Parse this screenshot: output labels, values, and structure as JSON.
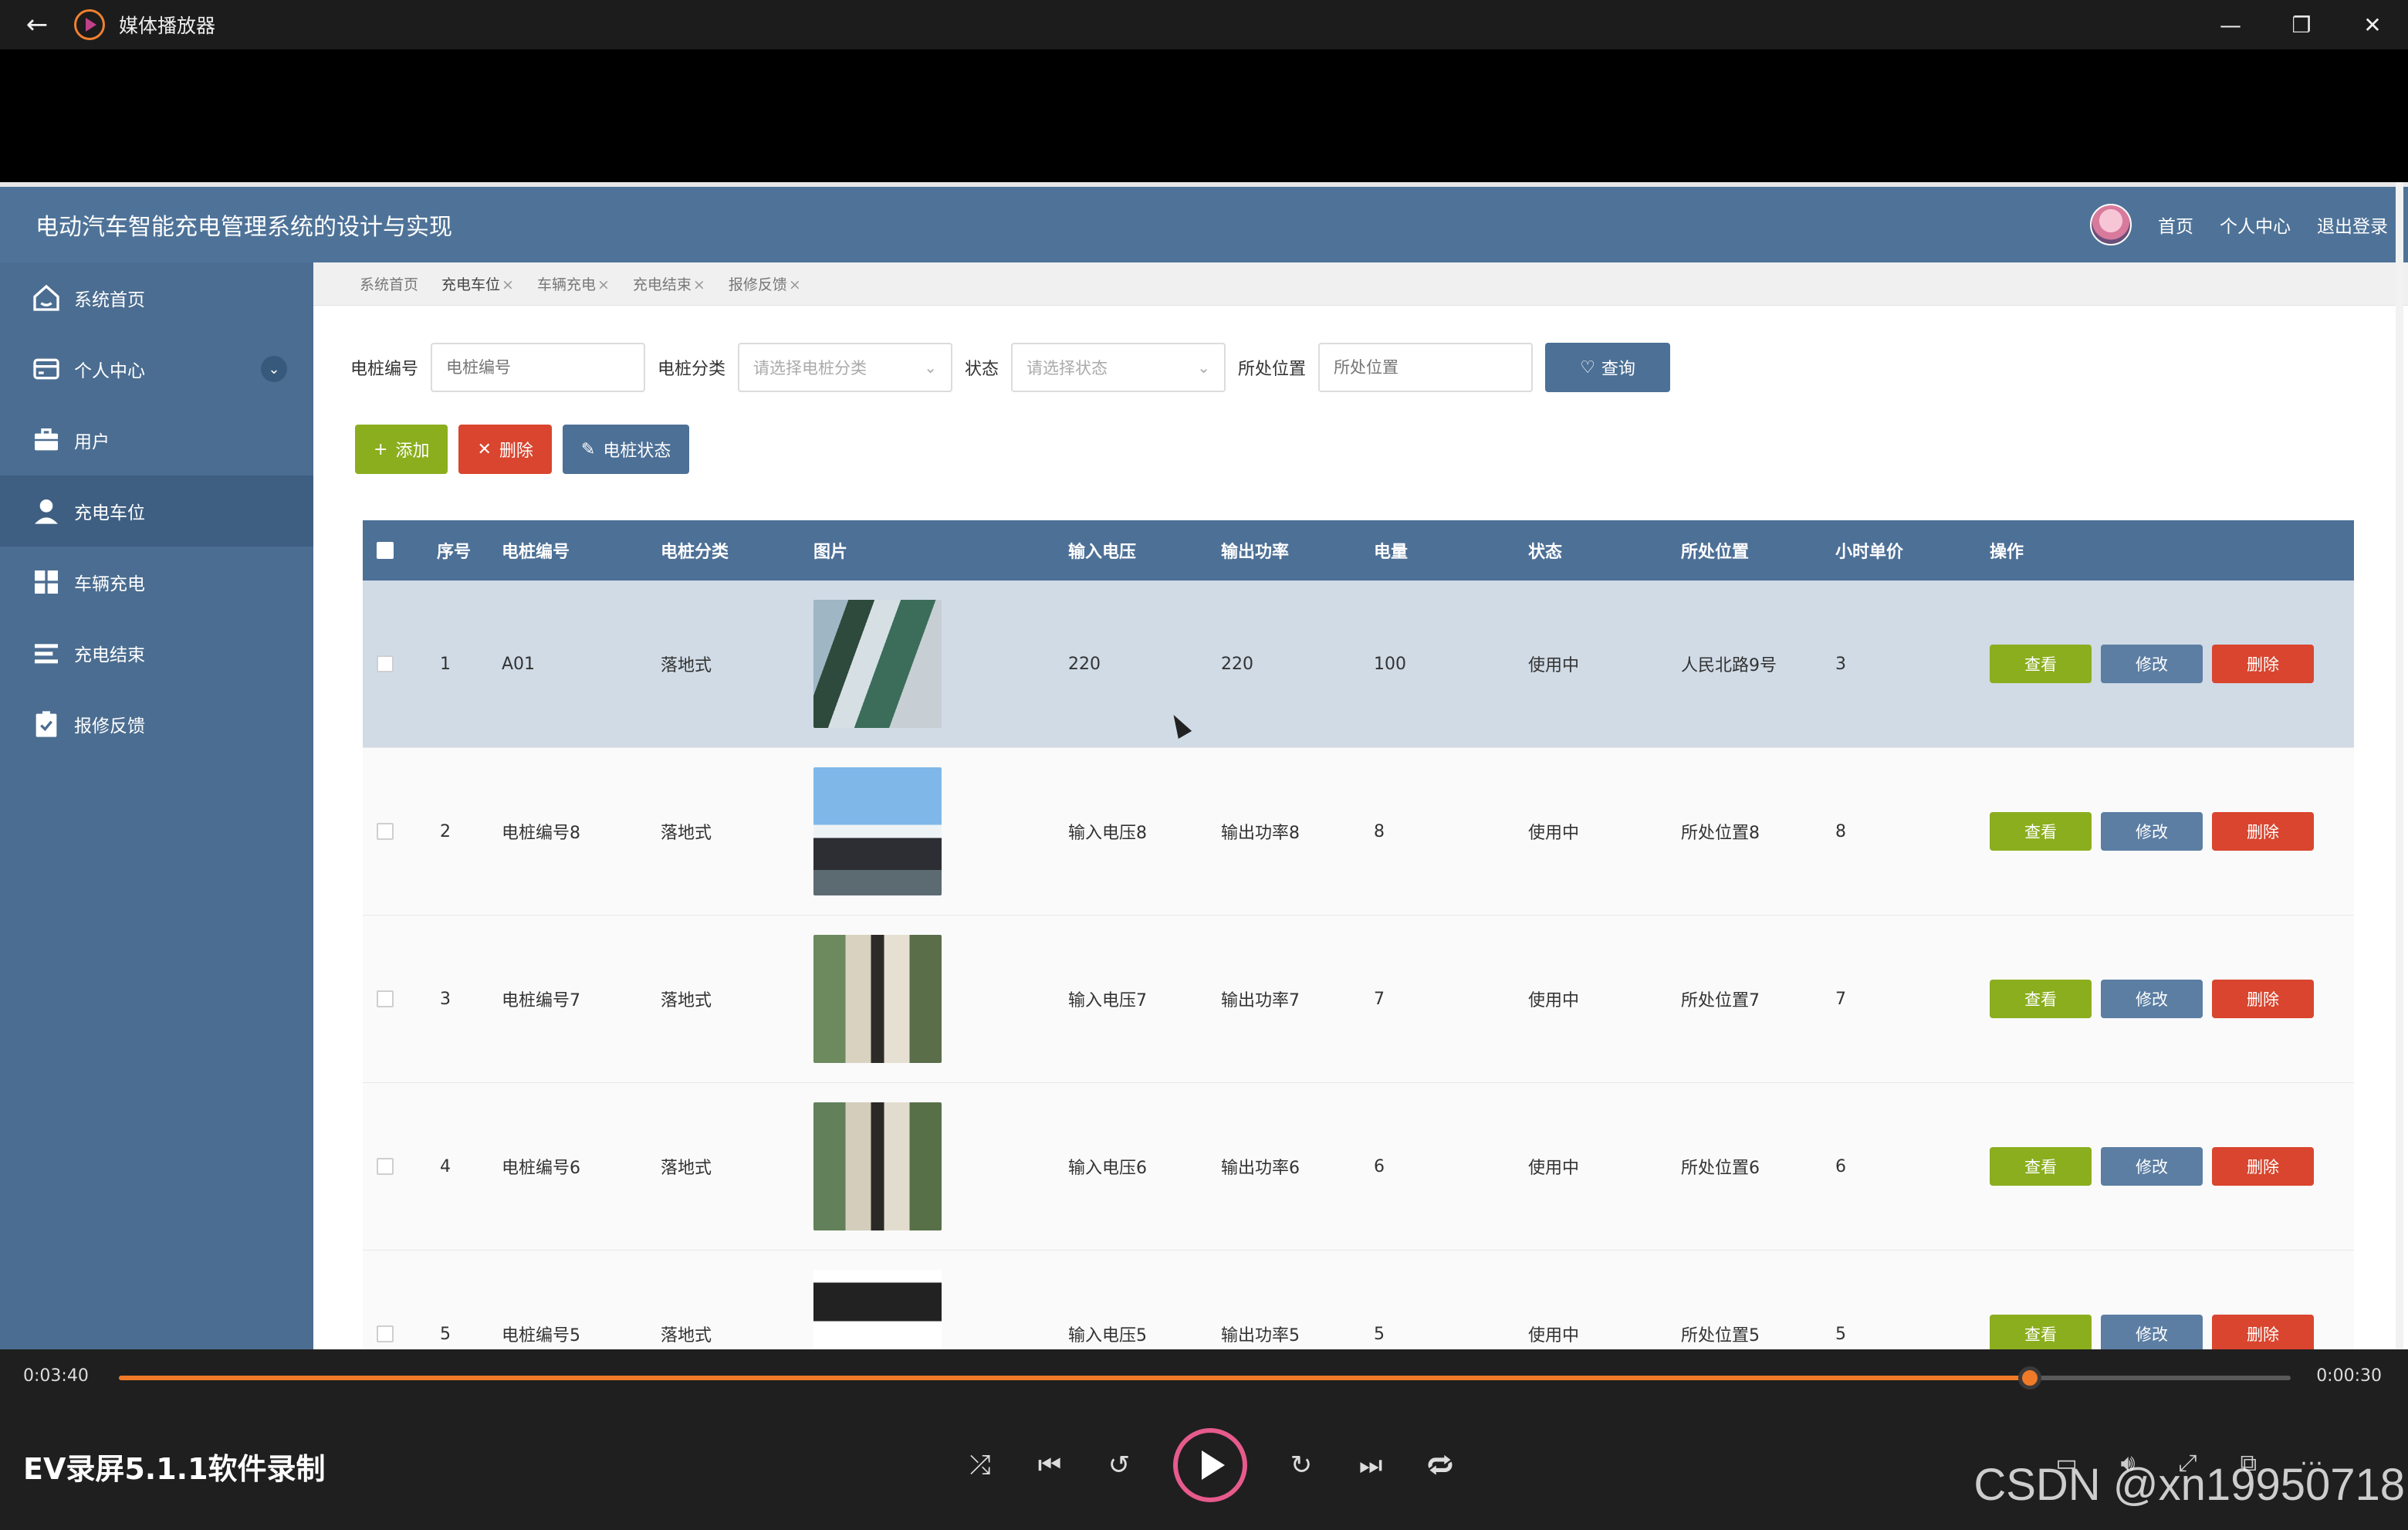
{
  "window": {
    "title": "媒体播放器",
    "controls": {
      "minimize": "—",
      "restore": "❐",
      "close": "✕"
    }
  },
  "app": {
    "title": "电动汽车智能充电管理系统的设计与实现",
    "header_links": [
      "首页",
      "个人中心",
      "退出登录"
    ]
  },
  "sidebar": {
    "items": [
      {
        "label": "系统首页",
        "icon": "home-icon"
      },
      {
        "label": "个人中心",
        "icon": "wallet-icon"
      },
      {
        "label": "用户",
        "icon": "briefcase-icon"
      },
      {
        "label": "充电车位",
        "icon": "person-icon"
      },
      {
        "label": "车辆充电",
        "icon": "grid-icon"
      },
      {
        "label": "充电结束",
        "icon": "list-icon"
      },
      {
        "label": "报修反馈",
        "icon": "clipboard-check-icon"
      }
    ]
  },
  "tabs": [
    "系统首页",
    "充电车位",
    "车辆充电",
    "充电结束",
    "报修反馈"
  ],
  "search": {
    "code_label": "电桩编号",
    "code_placeholder": "电桩编号",
    "category_label": "电桩分类",
    "category_placeholder": "请选择电桩分类",
    "status_label": "状态",
    "status_placeholder": "请选择状态",
    "location_label": "所处位置",
    "location_placeholder": "所处位置",
    "query_button": "查询"
  },
  "actions": {
    "add": "添加",
    "delete": "删除",
    "status": "电桩状态"
  },
  "table": {
    "headers": [
      "序号",
      "电桩编号",
      "电桩分类",
      "图片",
      "输入电压",
      "输出功率",
      "电量",
      "状态",
      "所处位置",
      "小时单价",
      "操作"
    ],
    "rows": [
      {
        "idx": "1",
        "code": "A01",
        "category": "落地式",
        "voltage": "220",
        "power": "220",
        "amount": "100",
        "status": "使用中",
        "location": "人民北路9号",
        "price": "3"
      },
      {
        "idx": "2",
        "code": "电桩编号8",
        "category": "落地式",
        "voltage": "输入电压8",
        "power": "输出功率8",
        "amount": "8",
        "status": "使用中",
        "location": "所处位置8",
        "price": "8"
      },
      {
        "idx": "3",
        "code": "电桩编号7",
        "category": "落地式",
        "voltage": "输入电压7",
        "power": "输出功率7",
        "amount": "7",
        "status": "使用中",
        "location": "所处位置7",
        "price": "7"
      },
      {
        "idx": "4",
        "code": "电桩编号6",
        "category": "落地式",
        "voltage": "输入电压6",
        "power": "输出功率6",
        "amount": "6",
        "status": "使用中",
        "location": "所处位置6",
        "price": "6"
      },
      {
        "idx": "5",
        "code": "电桩编号5",
        "category": "落地式",
        "voltage": "输入电压5",
        "power": "输出功率5",
        "amount": "5",
        "status": "使用中",
        "location": "所处位置5",
        "price": "5"
      }
    ],
    "row_actions": {
      "view": "查看",
      "edit": "修改",
      "delete": "删除"
    }
  },
  "player": {
    "elapsed": "0:03:40",
    "remaining": "0:00:30",
    "progress": 0.88,
    "media_title": "EV录屏5.1.1软件录制",
    "accent": "#f07a28"
  },
  "watermark": "CSDN @xn1995071​8"
}
